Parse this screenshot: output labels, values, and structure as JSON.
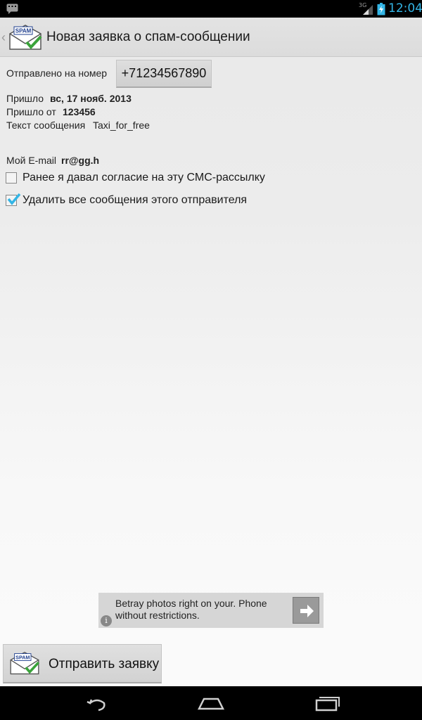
{
  "status_bar": {
    "network": "3G",
    "time": "12:04"
  },
  "action_bar": {
    "title": "Новая заявка о спам-сообщении",
    "icon_text": "SPAM"
  },
  "form": {
    "sent_to_label": "Отправлено на номер",
    "phone_number": "+71234567890",
    "arrived_label": "Пришло",
    "arrived_date": "вс, 17 нояб. 2013",
    "from_label": "Пришло от",
    "from_value": "123456",
    "message_label": "Текст сообщения",
    "message_value": "Taxi_for_free",
    "email_label": "Мой E-mail",
    "email_value": "rr@gg.h",
    "consent_label": "Ранее я давал согласие на эту СМС-рассылку",
    "consent_checked": false,
    "delete_label": "Удалить все сообщения этого отправителя",
    "delete_checked": true
  },
  "ad": {
    "text": "Betray photos right on your. Phone without restrictions.",
    "info_icon": "i"
  },
  "send_button": {
    "label": "Отправить заявку",
    "icon_text": "SPAM"
  },
  "nav_bar": {
    "icons": [
      "back-icon",
      "home-icon",
      "recent-apps-icon"
    ]
  },
  "colors": {
    "accent": "#33b5e5",
    "check": "#33b5e5"
  }
}
